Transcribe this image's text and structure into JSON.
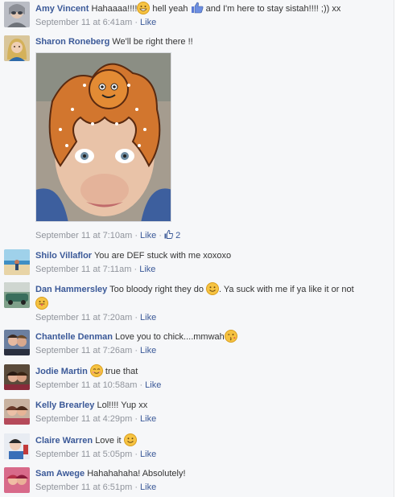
{
  "comments": [
    {
      "author": "Amy Vincent",
      "text_parts": [
        "Hahaaaa!!!!",
        " hell yeah",
        " and I'm here to stay sistah!!!! ;)) xx"
      ],
      "timestamp": "September 11 at 6:41am",
      "like_label": "Like",
      "avatar_icon": "profile-photo"
    },
    {
      "author": "Sharon Roneberg",
      "text": "We'll be right there !!",
      "timestamp": "September 11 at 7:10am",
      "like_label": "Like",
      "like_count": "2",
      "photo_icon": "face-paint-octopus-photo",
      "avatar_icon": "profile-photo"
    },
    {
      "author": "Shilo Villaflor",
      "text": "You are DEF stuck with me xoxoxo",
      "timestamp": "September 11 at 7:11am",
      "like_label": "Like",
      "avatar_icon": "profile-photo"
    },
    {
      "author": "Dan Hammersley",
      "text_parts": [
        "Too bloody right they do ",
        ". Ya suck with me if ya like it or not"
      ],
      "timestamp": "September 11 at 7:20am",
      "like_label": "Like",
      "avatar_icon": "profile-photo"
    },
    {
      "author": "Chantelle Denman",
      "text": "Love you to chick....mmwah",
      "timestamp": "September 11 at 7:26am",
      "like_label": "Like",
      "avatar_icon": "profile-photo"
    },
    {
      "author": "Jodie Martin",
      "text": " true that",
      "timestamp": "September 11 at 10:58am",
      "like_label": "Like",
      "avatar_icon": "profile-photo"
    },
    {
      "author": "Kelly Brearley",
      "text": "Lol!!!! Yup xx",
      "timestamp": "September 11 at 4:29pm",
      "like_label": "Like",
      "avatar_icon": "profile-photo"
    },
    {
      "author": "Claire Warren",
      "text": "Love it ",
      "timestamp": "September 11 at 5:05pm",
      "like_label": "Like",
      "avatar_icon": "profile-photo"
    },
    {
      "author": "Sam Awege",
      "text": "Hahahahaha! Absolutely!",
      "timestamp": "September 11 at 6:51pm",
      "like_label": "Like",
      "avatar_icon": "profile-photo"
    }
  ],
  "separator": " · ",
  "colors": {
    "link": "#3b5998",
    "meta": "#90949c",
    "background": "#f6f7f9"
  }
}
